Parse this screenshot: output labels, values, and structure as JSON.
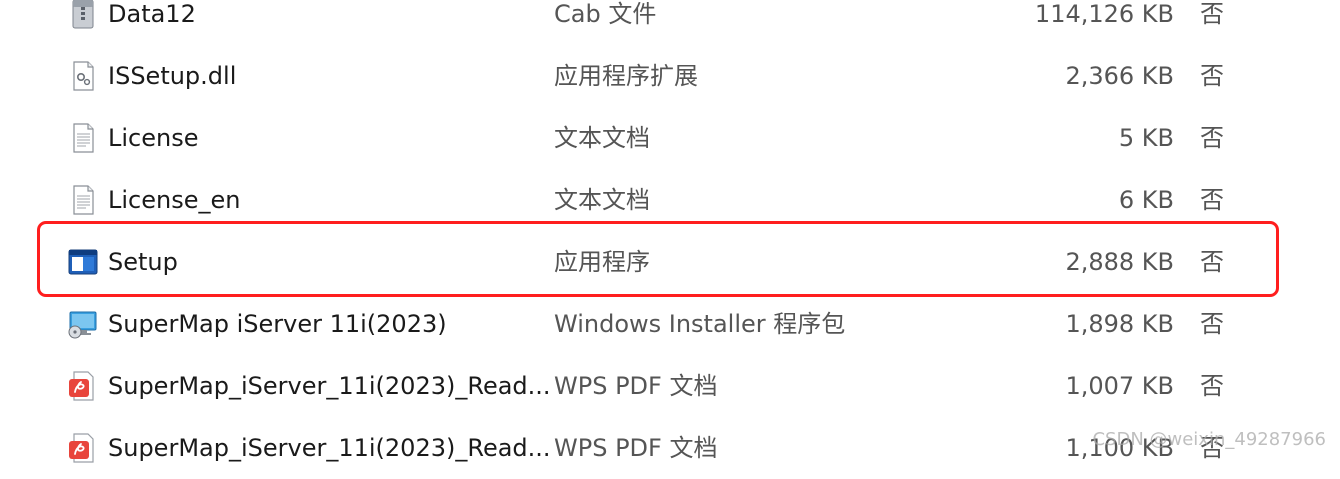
{
  "files": [
    {
      "name": "Data12",
      "type": "Cab 文件",
      "size": "114,126 KB",
      "compressed": "否",
      "icon": "cab-archive-icon"
    },
    {
      "name": "ISSetup.dll",
      "type": "应用程序扩展",
      "size": "2,366 KB",
      "compressed": "否",
      "icon": "dll-file-icon"
    },
    {
      "name": "License",
      "type": "文本文档",
      "size": "5 KB",
      "compressed": "否",
      "icon": "text-document-icon"
    },
    {
      "name": "License_en",
      "type": "文本文档",
      "size": "6 KB",
      "compressed": "否",
      "icon": "text-document-icon"
    },
    {
      "name": "Setup",
      "type": "应用程序",
      "size": "2,888 KB",
      "compressed": "否",
      "icon": "application-window-icon"
    },
    {
      "name": "SuperMap iServer 11i(2023)",
      "type": "Windows Installer 程序包",
      "size": "1,898 KB",
      "compressed": "否",
      "icon": "msi-installer-icon"
    },
    {
      "name": "SuperMap_iServer_11i(2023)_Read...",
      "type": "WPS PDF 文档",
      "size": "1,007 KB",
      "compressed": "否",
      "icon": "wps-pdf-icon"
    },
    {
      "name": "SuperMap_iServer_11i(2023)_Read...",
      "type": "WPS PDF 文档",
      "size": "1,100 KB",
      "compressed": "否",
      "icon": "wps-pdf-icon"
    }
  ],
  "highlight_color": "#ff1e1e",
  "watermark": "CSDN @weixin_49287966"
}
